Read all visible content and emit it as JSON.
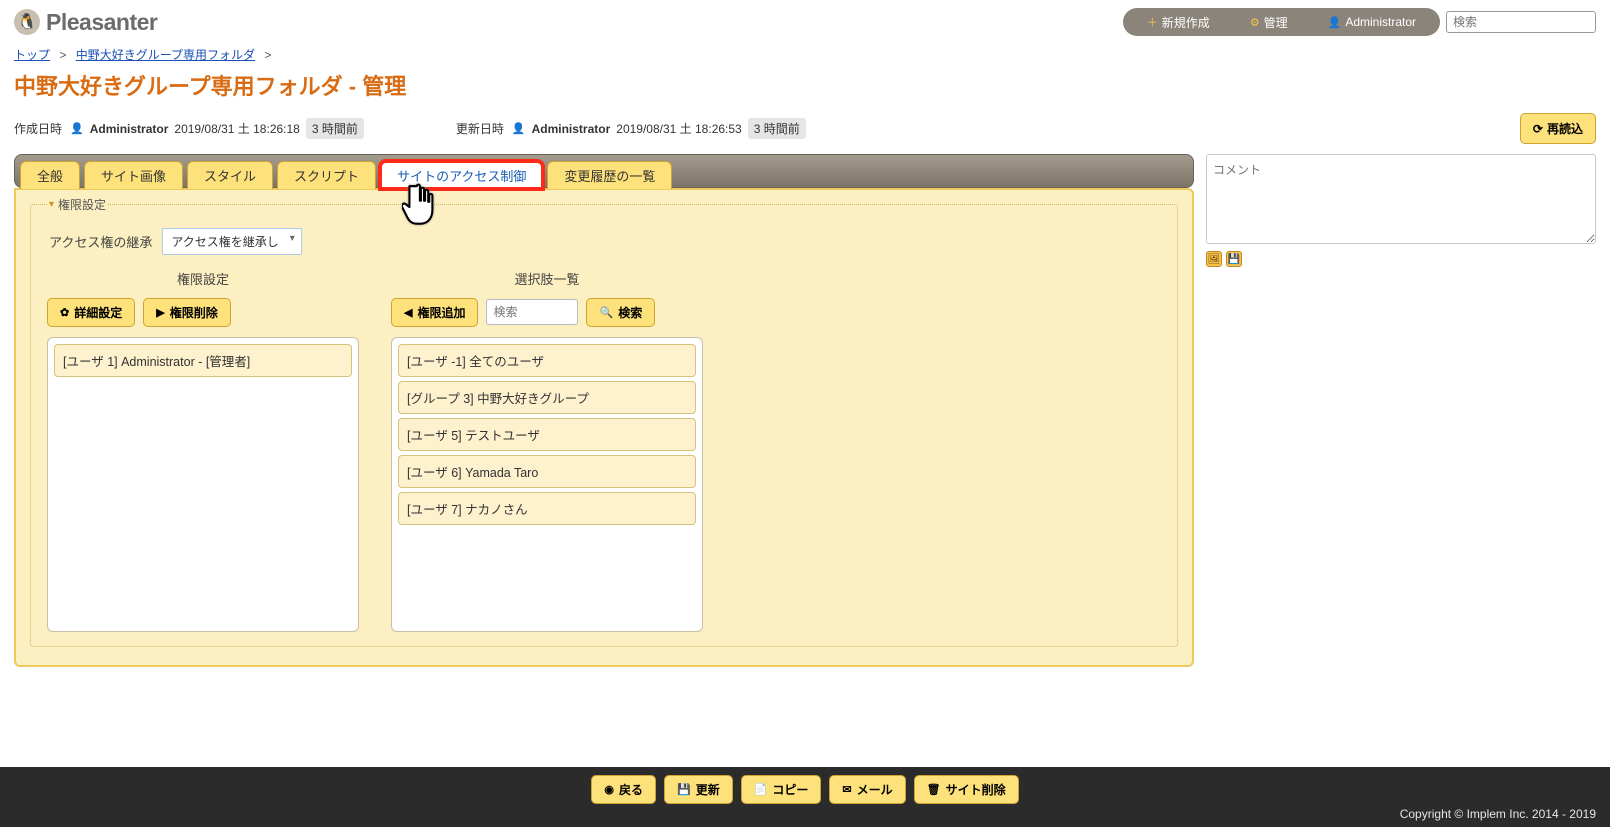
{
  "brand": "Pleasanter",
  "topbar": {
    "new": "新規作成",
    "admin": "管理",
    "user": "Administrator",
    "search_placeholder": "検索"
  },
  "breadcrumbs": [
    {
      "label": "トップ"
    },
    {
      "label": "中野大好きグループ専用フォルダ"
    }
  ],
  "title": "中野大好きグループ専用フォルダ - 管理",
  "meta": {
    "created_label": "作成日時",
    "created_user": "Administrator",
    "created_at": "2019/08/31 土 18:26:18",
    "created_rel": "3 時間前",
    "updated_label": "更新日時",
    "updated_user": "Administrator",
    "updated_at": "2019/08/31 土 18:26:53",
    "updated_rel": "3 時間前",
    "reload": "再読込"
  },
  "tabs": [
    "全般",
    "サイト画像",
    "スタイル",
    "スクリプト",
    "サイトのアクセス制御",
    "変更履歴の一覧"
  ],
  "fieldset_legend": "権限設定",
  "inherit": {
    "label": "アクセス権の継承",
    "value": "アクセス権を継承し"
  },
  "left_col": {
    "header": "権限設定",
    "btn_detail": "詳細設定",
    "btn_remove": "権限削除",
    "items": [
      "[ユーザ 1] Administrator - [管理者]"
    ]
  },
  "right_col": {
    "header": "選択肢一覧",
    "btn_add": "権限追加",
    "search_placeholder": "検索",
    "btn_search": "検索",
    "items": [
      "[ユーザ -1] 全てのユーザ",
      "[グループ 3] 中野大好きグループ",
      "[ユーザ 5] テストユーザ",
      "[ユーザ 6] Yamada Taro",
      "[ユーザ 7] ナカノさん"
    ]
  },
  "comment_placeholder": "コメント",
  "actions": {
    "back": "戻る",
    "update": "更新",
    "copy": "コピー",
    "mail": "メール",
    "delete": "サイト削除"
  },
  "copyright": "Copyright © Implem Inc. 2014 - 2019"
}
